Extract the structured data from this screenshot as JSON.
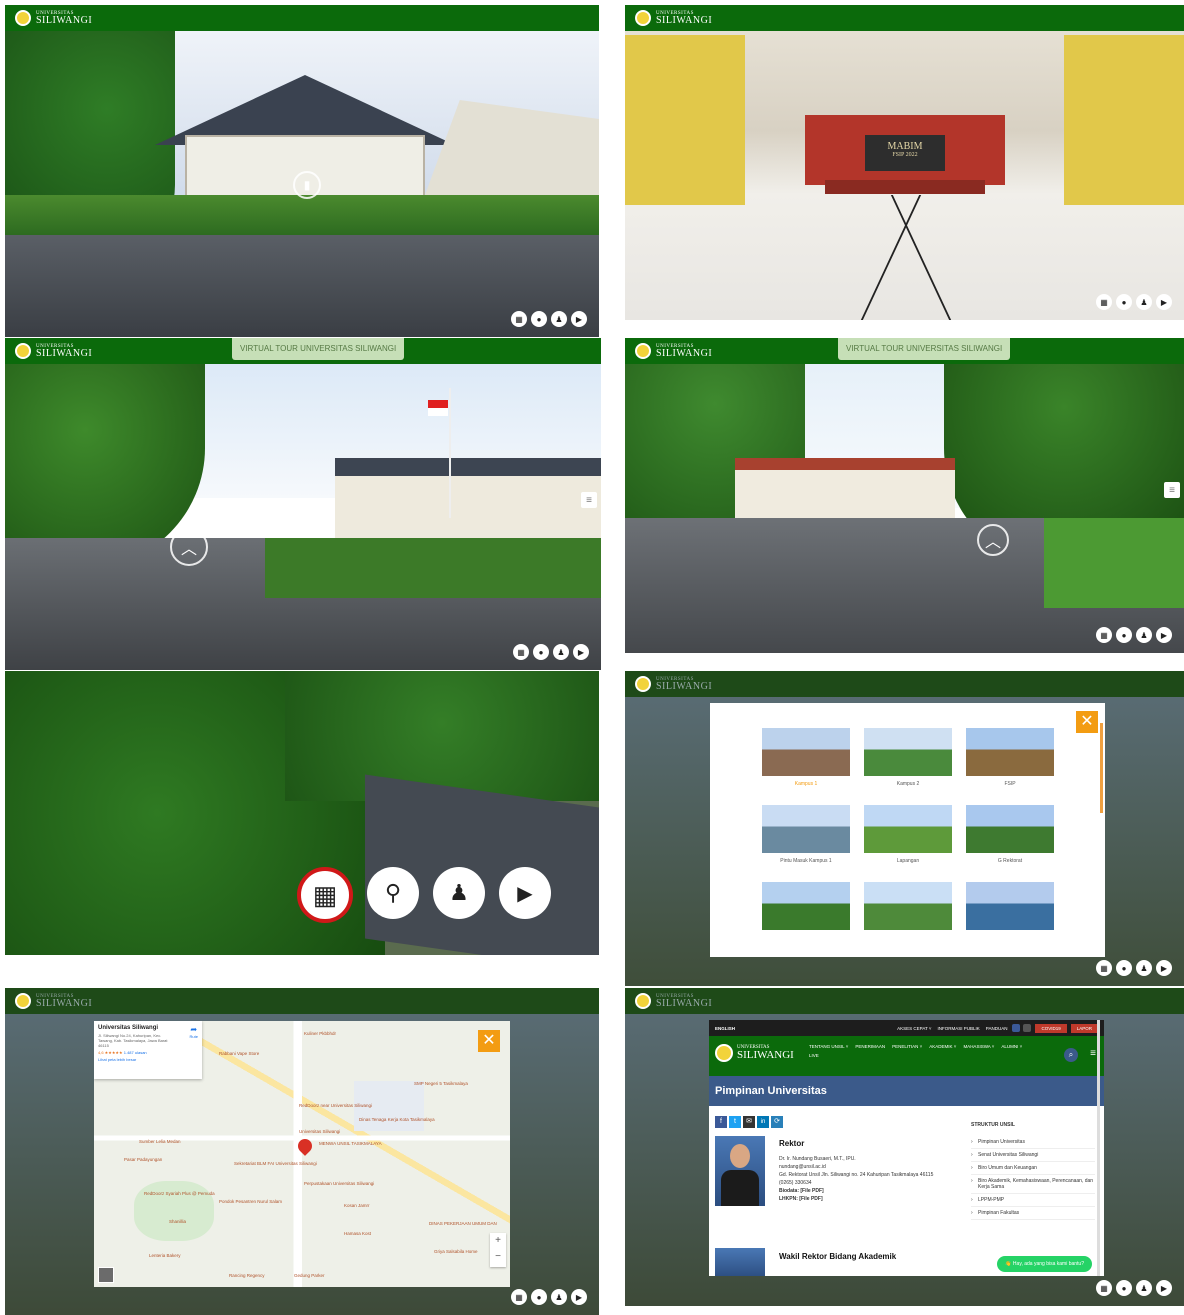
{
  "brand": {
    "small": "UNIVERSITAS",
    "name": "SILIWANGI"
  },
  "tour_label": "VIRTUAL TOUR UNIVERSITAS SILIWANGI",
  "hall_sign": {
    "title": "MABIM",
    "subtitle": "FSIP 2022"
  },
  "controls": [
    "grid-icon",
    "location-pin-icon",
    "person-icon",
    "play-icon"
  ],
  "gallery": {
    "items": [
      {
        "label": "Kampus 1",
        "active": true
      },
      {
        "label": "Kampus 2"
      },
      {
        "label": "FSIP"
      },
      {
        "label": "Pintu Masuk Kampus 1"
      },
      {
        "label": "Lapangan"
      },
      {
        "label": "G Rektorat"
      },
      {
        "label": ""
      },
      {
        "label": ""
      },
      {
        "label": ""
      }
    ]
  },
  "map": {
    "place_name": "Universitas Siliwangi",
    "address": "Jl. Siliwangi No.24, Kahuripan, Kec. Tawang, Kab. Tasikmalaya, Jawa Barat 46115",
    "directions": "Rute",
    "rating": "4,6 ★★★★★",
    "reviews": "1.487 ulasan",
    "larger_map": "Lihat peta lebih besar",
    "labels": [
      "Rabbani Vape Store",
      "Kuliner Pkbbhdr",
      "SMP Negeri 5 Tasikmalaya",
      "RedDoorz near Universitas Siliwangi",
      "Dinas Tenaga Kerja Kota Tasikmalaya",
      "Sumber Lelia Medan",
      "Pasar Padayungan",
      "Universitas Siliwangi",
      "MENWA UNSIL TASIKMALAYA",
      "Sekretariat BLM FAI Universitas Siliwangi",
      "Perpustakaan Universitas Siliwangi",
      "RedDoorz Syariah Plus @ Pemuda",
      "Pondok Pesantren Nurul Salam",
      "Shanillia",
      "Kosan Jamrr",
      "Hamasa Kost",
      "Lenteria Bakery",
      "DINAS PEKERJAAN UMUM DAN",
      "Griya Salsabila Home",
      "Rancing Regency",
      "Gedung Parker"
    ],
    "zoom_in": "+",
    "zoom_out": "−"
  },
  "website": {
    "topnav": {
      "lang": "ENGLISH",
      "links": [
        "AKSES CEPAT ˅",
        "INFORMASI PUBLIK",
        "PANDUAN"
      ],
      "covid": "COVID19",
      "lapor": "LAPOR"
    },
    "mainnav": [
      "TENTANG UNSIL ˅",
      "PENERIMAAN",
      "PENELITIAN ˅",
      "AKADEMIK ˅",
      "MAHASISWA ˅",
      "ALUMNI ˅",
      "LIVE"
    ],
    "page_title": "Pimpinan Universitas",
    "rektor": {
      "role": "Rektor",
      "name": "Dr. Ir. Nundang Busaeri, M.T., IPU.",
      "email": "nundang@unsil.ac.id",
      "address": "Gd. Rektorat Unsil Jln. Siliwangi no. 24 Kahuripan Tasikmalaya 46115",
      "phone": "(0265) 330634",
      "biodata": "Biodata: [File PDF]",
      "lhkpn": "LHKPN: [File PDF]"
    },
    "wakil_role": "Wakil Rektor Bidang Akademik",
    "sidebar": {
      "heading": "STRUKTUR UNSIL",
      "items": [
        "Pimpinan Universitas",
        "Senat Universitas Siliwangi",
        "Biro Umum dan Keuangan",
        "Biro Akademik, Kemahasiswaan, Perencanaan, dan Kerja Sama",
        "LPPM-PMP",
        "Pimpinan Fakultas"
      ]
    },
    "chat": "👋 Hay, ada yang bisa kami bantu?"
  },
  "colors": {
    "green": "#0b6a0b",
    "orange": "#f39c12",
    "red": "#c0392b",
    "navy": "#3b5a8a"
  }
}
